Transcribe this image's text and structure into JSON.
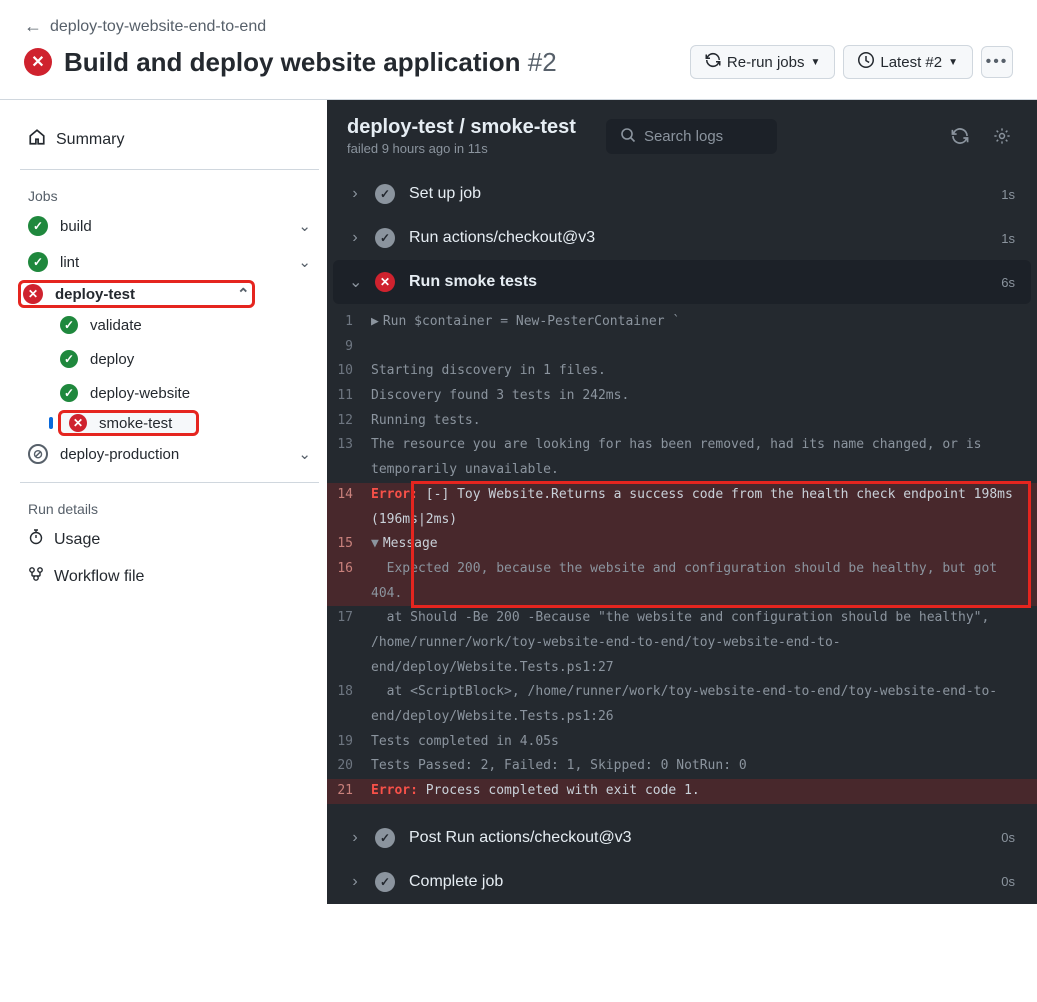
{
  "breadcrumb": "deploy-toy-website-end-to-end",
  "workflow_title": "Build and deploy website application",
  "run_number": "#2",
  "buttons": {
    "rerun": "Re-run jobs",
    "latest": "Latest #2"
  },
  "sidebar": {
    "summary": "Summary",
    "jobs_label": "Jobs",
    "run_details_label": "Run details",
    "usage": "Usage",
    "workflow_file": "Workflow file",
    "jobs": [
      {
        "name": "build",
        "status": "pass",
        "expandable": true
      },
      {
        "name": "lint",
        "status": "pass",
        "expandable": true
      },
      {
        "name": "deploy-test",
        "status": "fail",
        "expandable": true,
        "expanded": true,
        "annot": true
      },
      {
        "name": "validate",
        "status": "pass",
        "indent": true
      },
      {
        "name": "deploy",
        "status": "pass",
        "indent": true
      },
      {
        "name": "deploy-website",
        "status": "pass",
        "indent": true
      },
      {
        "name": "smoke-test",
        "status": "fail",
        "indent": true,
        "selected": true,
        "annot": true
      },
      {
        "name": "deploy-production",
        "status": "skip",
        "expandable": true
      }
    ]
  },
  "log_header": {
    "title": "deploy-test / smoke-test",
    "subtitle": "failed 9 hours ago in 11s",
    "search_placeholder": "Search logs"
  },
  "steps": [
    {
      "name": "Set up job",
      "status": "done",
      "time": "1s",
      "expanded": false
    },
    {
      "name": "Run actions/checkout@v3",
      "status": "done",
      "time": "1s",
      "expanded": false
    },
    {
      "name": "Run smoke tests",
      "status": "fail",
      "time": "6s",
      "expanded": true
    },
    {
      "name": "Post Run actions/checkout@v3",
      "status": "done",
      "time": "0s",
      "expanded": false
    },
    {
      "name": "Complete job",
      "status": "done",
      "time": "0s",
      "expanded": false
    }
  ],
  "log": {
    "line1_cmd": "Run $container = New-PesterContainer `",
    "line10": "Starting discovery in 1 files.",
    "line11": "Discovery found 3 tests in 242ms.",
    "line12": "Running tests.",
    "line13": "The resource you are looking for has been removed, had its name changed, or is temporarily unavailable.",
    "line14_err": "Error:",
    "line14_body": " [-] Toy Website.Returns a success code from the health check endpoint 198ms (196ms|2ms)",
    "line15_tri": "▼",
    "line15_body": "Message",
    "line16": "  Expected 200, because the website and configuration should be healthy, but got 404.",
    "line17": "  at Should -Be 200 -Because \"the website and configuration should be healthy\", /home/runner/work/toy-website-end-to-end/toy-website-end-to-end/deploy/Website.Tests.ps1:27",
    "line18": "  at <ScriptBlock>, /home/runner/work/toy-website-end-to-end/toy-website-end-to-end/deploy/Website.Tests.ps1:26",
    "line19": "Tests completed in 4.05s",
    "line20": "Tests Passed: 2, Failed: 1, Skipped: 0 NotRun: 0",
    "line21_err": "Error:",
    "line21_body": " Process completed with exit code 1."
  }
}
